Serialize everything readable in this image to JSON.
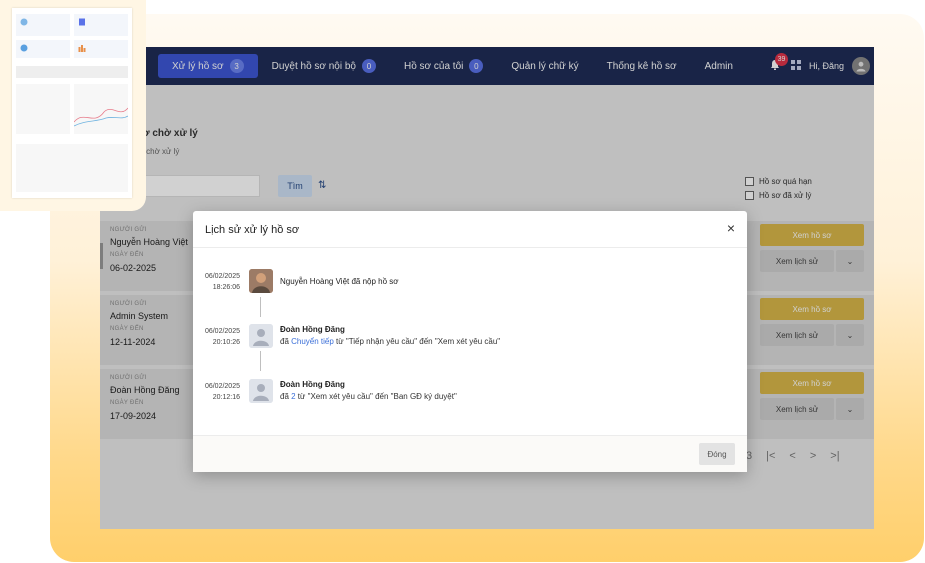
{
  "nav": {
    "prefix": "ơ",
    "items": [
      {
        "label": "Xử lý hồ sơ",
        "badge": "3"
      },
      {
        "label": "Duyệt hồ sơ nội bộ",
        "badge": "0"
      },
      {
        "label": "Hồ sơ của tôi",
        "badge": "0"
      },
      {
        "label": "Quản lý chữ ký",
        "badge": ""
      },
      {
        "label": "Thống kê hồ sơ",
        "badge": ""
      },
      {
        "label": "Admin",
        "badge": ""
      }
    ],
    "notification_count": "39",
    "greeting": "Hi, Đăng"
  },
  "page": {
    "breadcrumb": "ý",
    "title": "ồ sơ chờ xử lý",
    "subtitle": "ồ sơ chờ xử lý",
    "search_button": "Tìm",
    "filter_overdue": "Hồ sơ quá hạn",
    "filter_processed": "Hồ sơ đã xử lý"
  },
  "cards": [
    {
      "sender_label": "NGƯỜI GỬI",
      "sender": "Nguyễn Hoàng Việt",
      "date_label": "NGÀY ĐẾN",
      "date": "06-02-2025",
      "view_label": "Xem hồ sơ",
      "history_label": "Xem lịch sử"
    },
    {
      "sender_label": "NGƯỜI GỬI",
      "sender": "Admin System",
      "date_label": "NGÀY ĐẾN",
      "date": "12-11-2024",
      "view_label": "Xem hồ sơ",
      "history_label": "Xem lịch sử"
    },
    {
      "sender_label": "NGƯỜI GỬI",
      "sender": "Đoàn Hồng Đăng",
      "date_label": "NGÀY ĐẾN",
      "date": "17-09-2024",
      "view_label": "Xem hồ sơ",
      "history_label": "Xem lịch sử"
    }
  ],
  "pager": {
    "page": "3",
    "first": "|<",
    "prev": "<",
    "next": ">",
    "last": ">|"
  },
  "modal": {
    "title": "Lịch sử xử lý hồ sơ",
    "close_icon": "×",
    "close_button": "Đóng",
    "entries": [
      {
        "date": "06/02/2025",
        "time": "18:26:06",
        "line1": "Nguyễn Hoàng Việt đã nộp hồ sơ",
        "line2_prefix": "",
        "line2_link": "",
        "line2_suffix": ""
      },
      {
        "date": "06/02/2025",
        "time": "20:10:26",
        "line1": "Đoàn Hồng Đăng",
        "line2_prefix": "đã ",
        "line2_link": "Chuyển tiếp",
        "line2_suffix": " từ \"Tiếp nhận yêu cầu\" đến \"Xem xét yêu cầu\""
      },
      {
        "date": "06/02/2025",
        "time": "20:12:16",
        "line1": "Đoàn Hồng Đăng",
        "line2_prefix": "đã ",
        "line2_link": "2",
        "line2_suffix": " từ \"Xem xét yêu cầu\" đến \"Ban GĐ ký duyệt\""
      }
    ]
  },
  "colors": {
    "nav_bg": "#1f2d57",
    "active_tab": "#3d57d6",
    "view_button": "#d9b84a",
    "link": "#3b6fd8"
  }
}
